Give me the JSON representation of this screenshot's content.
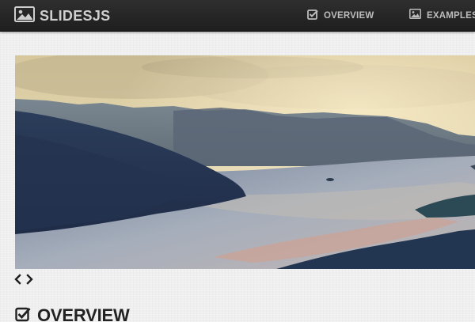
{
  "brand": {
    "name": "SLIDESJS",
    "icon": "picture-icon"
  },
  "nav": {
    "items": [
      {
        "label": "OVERVIEW",
        "icon": "checkbox-icon"
      },
      {
        "label": "EXAMPLES",
        "icon": "picture-icon"
      }
    ]
  },
  "slideshow": {
    "pager": {
      "prev_icon": "chevron-left-icon",
      "next_icon": "chevron-right-icon"
    }
  },
  "section": {
    "title": "OVERVIEW",
    "icon": "checkbox-icon"
  },
  "colors": {
    "navbar": "#252525",
    "nav_text": "#bdbdbd",
    "brand_text": "#cfcfcf",
    "page_bg": "#efefef",
    "heading": "#222222"
  }
}
